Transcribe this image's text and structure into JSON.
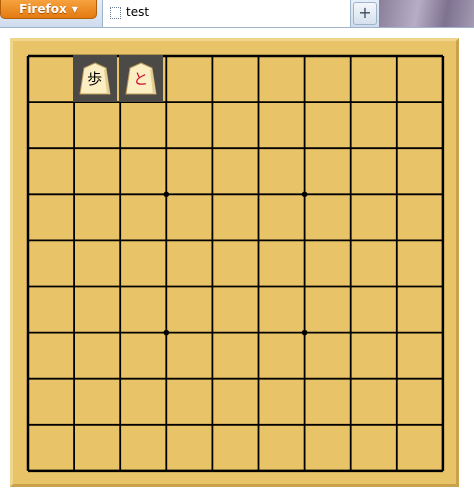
{
  "browser": {
    "menu_button_label": "Firefox",
    "tab_title": "test",
    "new_tab_label": "+"
  },
  "board": {
    "files": 9,
    "ranks": 9,
    "board_color": "#e8c368",
    "line_color": "#000000",
    "star_points": [
      [
        3,
        3
      ],
      [
        6,
        3
      ],
      [
        3,
        6
      ],
      [
        6,
        6
      ]
    ],
    "pieces": [
      {
        "name": "pawn",
        "glyph": "歩",
        "color": "#000000",
        "file": 1,
        "rank": 0,
        "selected": true
      },
      {
        "name": "promoted-pawn",
        "glyph": "と",
        "color": "#c8102e",
        "file": 2,
        "rank": 0,
        "selected": true
      }
    ]
  }
}
